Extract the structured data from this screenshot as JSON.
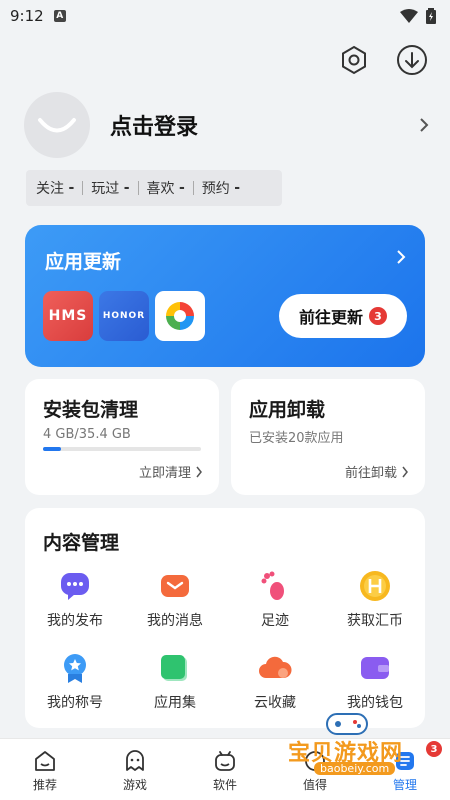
{
  "status_bar": {
    "time": "9:12",
    "indicator": "A"
  },
  "profile": {
    "login_text": "点击登录"
  },
  "stats": [
    {
      "label": "关注",
      "value": "-"
    },
    {
      "label": "玩过",
      "value": "-"
    },
    {
      "label": "喜欢",
      "value": "-"
    },
    {
      "label": "预约",
      "value": "-"
    }
  ],
  "update_card": {
    "title": "应用更新",
    "apps": [
      {
        "name": "HMS",
        "icon": "hms-icon"
      },
      {
        "name": "HONOR",
        "icon": "honor-icon"
      },
      {
        "name": "",
        "icon": "app-store-icon"
      }
    ],
    "button_label": "前往更新",
    "badge_count": "3",
    "colors": {
      "gradient_start": "#3d9bf6",
      "gradient_end": "#1c74ec"
    }
  },
  "package_card": {
    "title": "安装包清理",
    "storage_text": "4 GB/35.4 GB",
    "used_fraction": 0.113,
    "link": "立即清理"
  },
  "uninstall_card": {
    "title": "应用卸载",
    "subtitle": "已安装20款应用",
    "link": "前往卸载"
  },
  "content_mgmt": {
    "title": "内容管理",
    "items": [
      {
        "label": "我的发布",
        "icon": "chat-bubble-icon",
        "color": "#6b5cf0"
      },
      {
        "label": "我的消息",
        "icon": "mail-icon",
        "color": "#f46a3c"
      },
      {
        "label": "足迹",
        "icon": "footprint-icon",
        "color": "#f0507a"
      },
      {
        "label": "获取汇币",
        "icon": "coin-icon",
        "color": "#f7b81f"
      },
      {
        "label": "我的称号",
        "icon": "medal-icon",
        "color": "#3d9bf6"
      },
      {
        "label": "应用集",
        "icon": "collection-icon",
        "color": "#2fc36f"
      },
      {
        "label": "云收藏",
        "icon": "cloud-icon",
        "color": "#f46a3c"
      },
      {
        "label": "我的钱包",
        "icon": "wallet-icon",
        "color": "#8a5cf0"
      }
    ]
  },
  "bottom_nav": [
    {
      "label": "推荐",
      "icon": "home-icon"
    },
    {
      "label": "游戏",
      "icon": "game-icon"
    },
    {
      "label": "软件",
      "icon": "software-icon"
    },
    {
      "label": "值得",
      "icon": "worth-icon"
    },
    {
      "label": "管理",
      "icon": "manage-icon",
      "badge": "3"
    }
  ],
  "watermark": {
    "text": "宝贝游戏网",
    "url": "baobeiy.com"
  }
}
